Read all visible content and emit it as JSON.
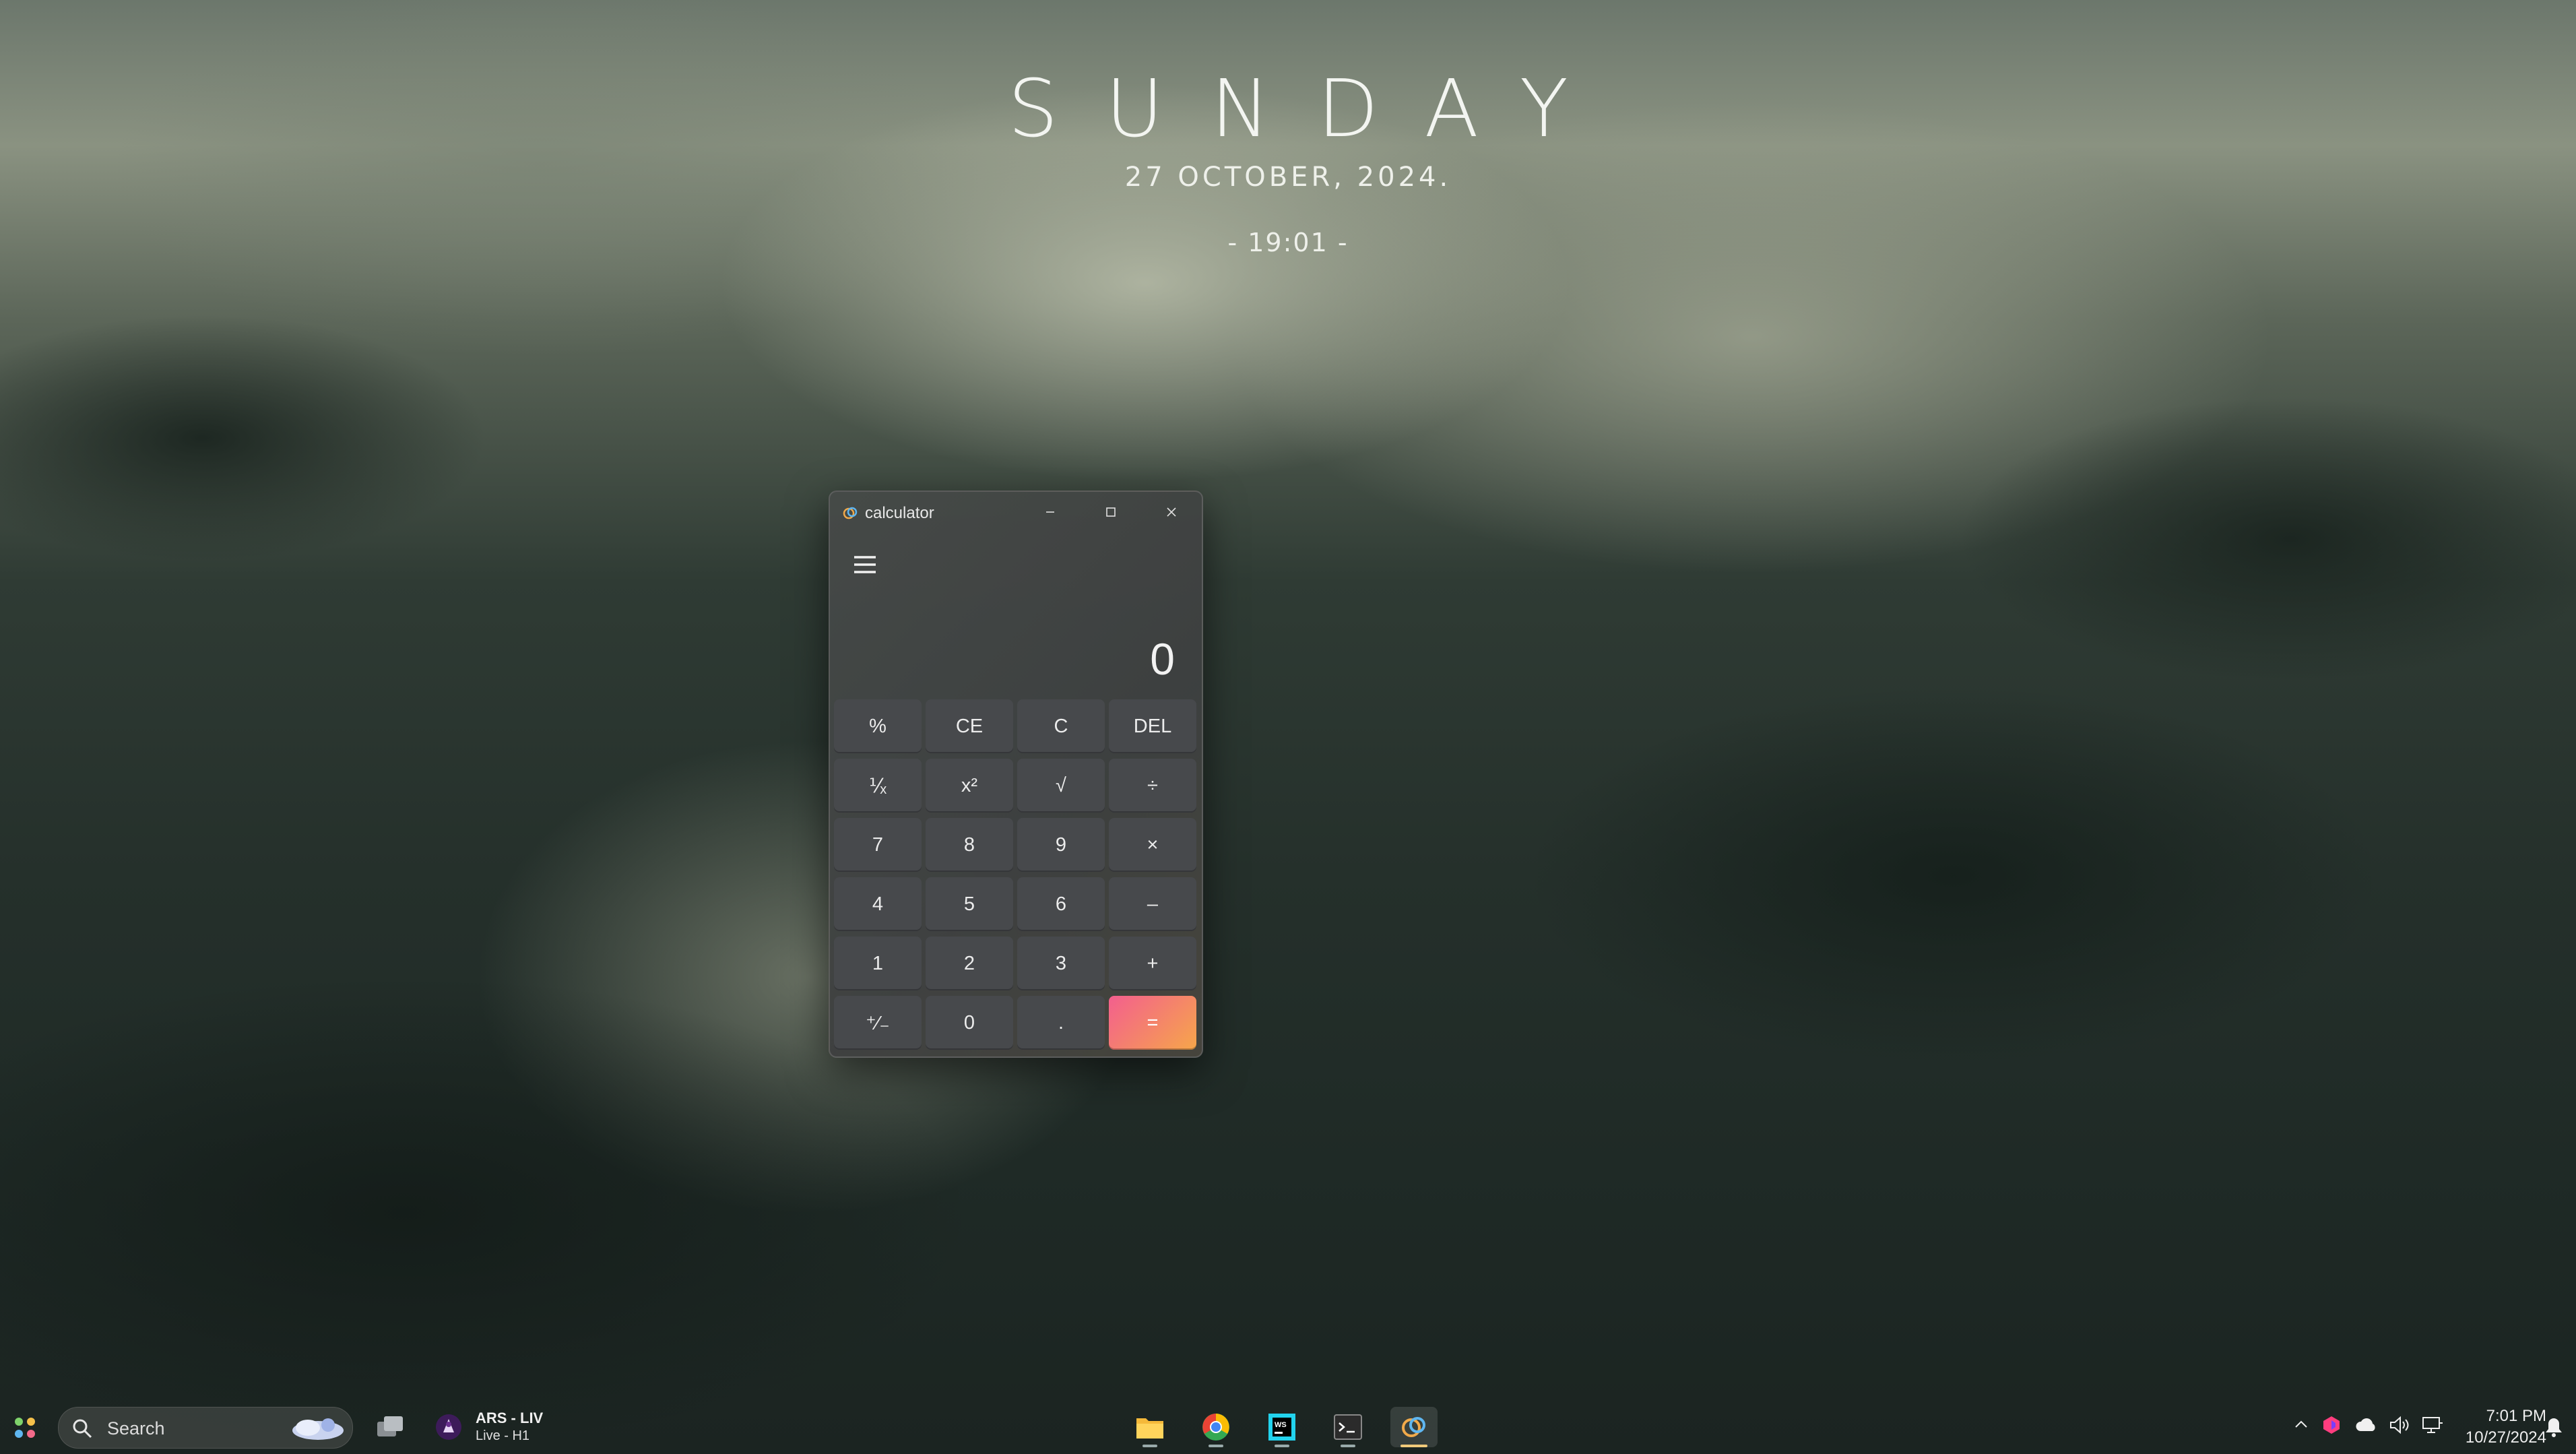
{
  "desktop": {
    "day": "SUNDAY",
    "date": "27 OCTOBER, 2024.",
    "time": "- 19:01 -"
  },
  "calculator": {
    "title": "calculator",
    "display_value": "0",
    "window_buttons": [
      "minimize",
      "maximize",
      "close"
    ],
    "keys": [
      "%",
      "CE",
      "C",
      "DEL",
      "⅟ₓ",
      "x²",
      "√",
      "÷",
      "7",
      "8",
      "9",
      "×",
      "4",
      "5",
      "6",
      "–",
      "1",
      "2",
      "3",
      "+",
      "⁺∕₋",
      "0",
      ".",
      "="
    ],
    "equals_gradient": [
      "#f35f8e",
      "#f6a64a"
    ]
  },
  "taskbar": {
    "search_placeholder": "Search",
    "widget": {
      "title": "ARS - LIV",
      "subtitle": "Live - H1"
    },
    "pinned_apps": [
      "file-explorer",
      "chrome",
      "webstorm",
      "terminal",
      "calculator"
    ],
    "tray": {
      "time": "7:01 PM",
      "date": "10/27/2024"
    }
  }
}
